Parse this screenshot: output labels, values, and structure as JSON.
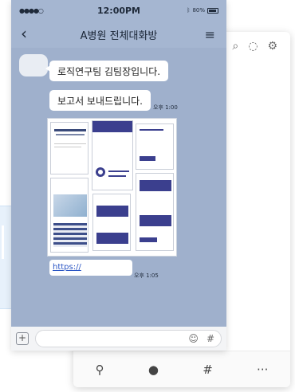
{
  "status": {
    "signal": "●●●●○",
    "wifi": "≋",
    "time": "12:00PM",
    "battery": "80%"
  },
  "header": {
    "title": "A병원 전체대화방"
  },
  "messages": [
    {
      "text": "로직연구팀 김팀장입니다."
    },
    {
      "text": "보고서 보내드립니다.",
      "time": "오후 1:00"
    }
  ],
  "link": {
    "text": "https://",
    "time": "오후 1:05"
  },
  "input": {
    "placeholder": ""
  },
  "icons": {
    "back": "chevron-left-icon",
    "menu": "hamburger-menu-icon",
    "attach": "plus-icon",
    "emoji": "emoji-icon",
    "hashtag": "hashtag-icon"
  },
  "back_window": {
    "top_icons": [
      "search-icon",
      "chat-icon",
      "settings-icon"
    ],
    "nav": [
      "friends-icon",
      "chats-icon",
      "hashtag-icon",
      "more-icon"
    ]
  },
  "colors": {
    "chat_bg": "#9fb0cc",
    "link": "#2a55c4",
    "doc_accent": "#3b3f8e"
  }
}
